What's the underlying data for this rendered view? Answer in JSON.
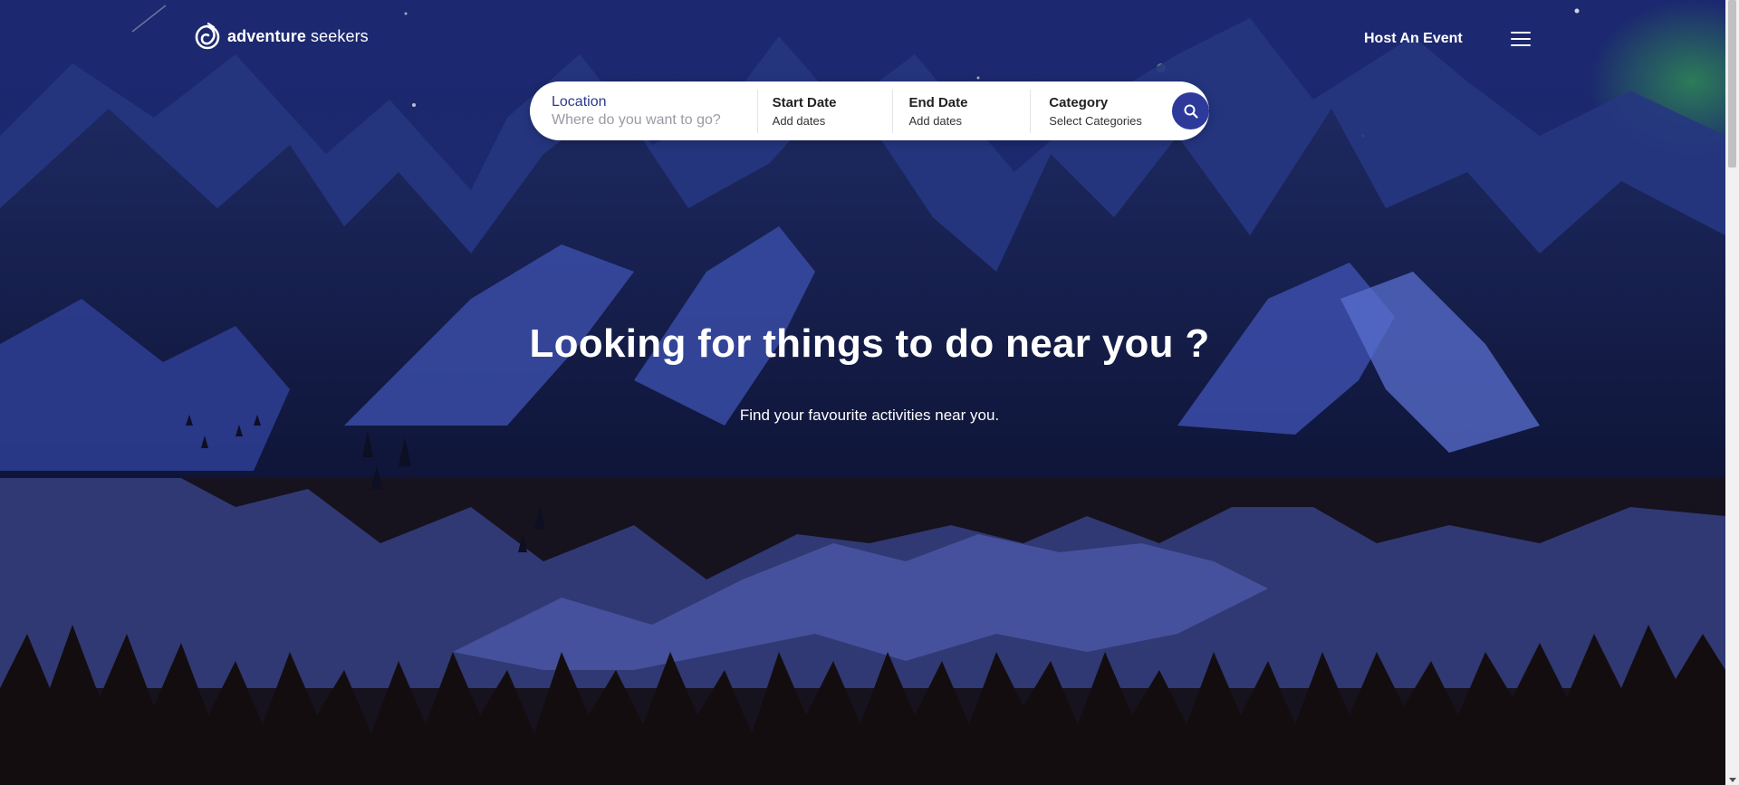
{
  "brand": {
    "name_bold": "adventure",
    "name_light": "seekers",
    "logo_icon": "swirl-logo-icon"
  },
  "nav": {
    "host_label": "Host An Event",
    "menu_icon": "hamburger-menu-icon"
  },
  "search": {
    "location_label": "Location",
    "location_placeholder": "Where do you want to go?",
    "location_value": "",
    "start_label": "Start Date",
    "start_value": "Add dates",
    "end_label": "End Date",
    "end_value": "Add dates",
    "category_label": "Category",
    "category_value": "Select Categories",
    "button_icon": "search-icon"
  },
  "hero": {
    "title": "Looking for things to do near you ?",
    "subtitle": "Find your favourite activities near you."
  },
  "colors": {
    "accent": "#2d3a9b",
    "location_label": "#2c3a8e",
    "sky_top": "#1a2466",
    "ground": "#150f12"
  }
}
